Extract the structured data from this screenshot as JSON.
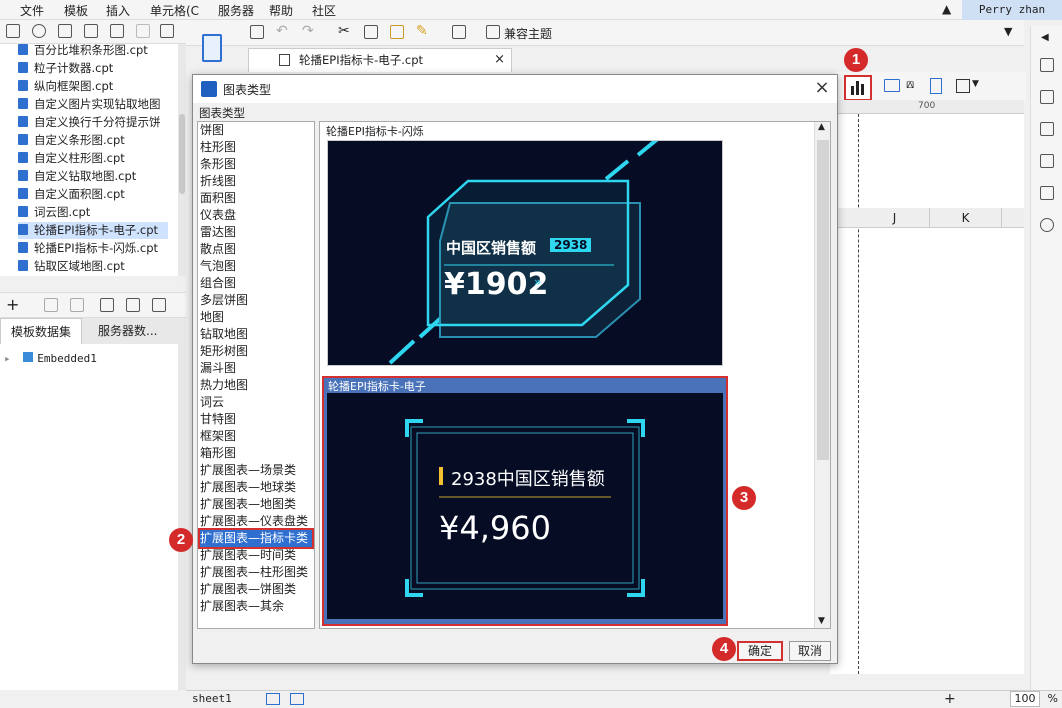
{
  "menu": [
    "文件",
    "模板",
    "插入",
    "单元格(C",
    "服务器",
    "帮助",
    "社区"
  ],
  "user": "Perry zhan",
  "tree_items": [
    {
      "label": "百分比堆积条形图.cpt",
      "selected": false
    },
    {
      "label": "粒子计数器.cpt",
      "selected": false
    },
    {
      "label": "纵向框架图.cpt",
      "selected": false
    },
    {
      "label": "自定义图片实现钻取地图",
      "selected": false
    },
    {
      "label": "自定义换行千分符提示饼",
      "selected": false
    },
    {
      "label": "自定义条形图.cpt",
      "selected": false
    },
    {
      "label": "自定义柱形图.cpt",
      "selected": false
    },
    {
      "label": "自定义钻取地图.cpt",
      "selected": false
    },
    {
      "label": "自定义面积图.cpt",
      "selected": false
    },
    {
      "label": "词云图.cpt",
      "selected": false
    },
    {
      "label": "轮播EPI指标卡-电子.cpt",
      "selected": true
    },
    {
      "label": "轮播EPI指标卡-闪烁.cpt",
      "selected": false
    },
    {
      "label": "钻取区域地图.cpt",
      "selected": false
    }
  ],
  "ds_tabs": [
    "模板数据集",
    "服务器数..."
  ],
  "ds_item": "Embedded1",
  "toolbar": {
    "compat_theme": "兼容主题"
  },
  "template_tab": "轮播EPI指标卡-电子.cpt",
  "ruler_mark": "700",
  "columns": [
    "J",
    "K"
  ],
  "dialog": {
    "title": "图表类型",
    "group_label": "图表类型",
    "ok": "确定",
    "cancel": "取消",
    "types": [
      "饼图",
      "柱形图",
      "条形图",
      "折线图",
      "面积图",
      "仪表盘",
      "雷达图",
      "散点图",
      "气泡图",
      "组合图",
      "多层饼图",
      "地图",
      "钻取地图",
      "矩形树图",
      "漏斗图",
      "热力地图",
      "词云",
      "甘特图",
      "框架图",
      "箱形图",
      "扩展图表—场景类",
      "扩展图表—地球类",
      "扩展图表—地图类",
      "扩展图表—仪表盘类",
      "扩展图表—指标卡类",
      "扩展图表—时间类",
      "扩展图表—柱形图类",
      "扩展图表—饼图类",
      "扩展图表—其余"
    ],
    "selected_type_index": 24,
    "preview1": {
      "label": "轮播EPI指标卡-闪烁",
      "title": "中国区销售额",
      "badge": "2938",
      "value": "¥1902"
    },
    "preview2": {
      "label": "轮播EPI指标卡-电子",
      "title": "2938中国区销售额",
      "value": "¥4,960"
    }
  },
  "badges": [
    "1",
    "2",
    "3",
    "4"
  ],
  "sheet": "sheet1",
  "zoom": "100",
  "colors": {
    "accent": "#d43030",
    "selection": "#2f6fd0",
    "card_bg": "#050c24",
    "cyan": "#2fd6f0"
  }
}
